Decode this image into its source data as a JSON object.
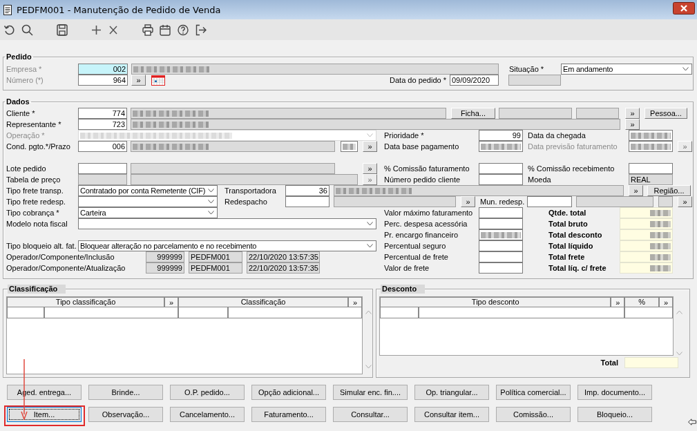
{
  "window": {
    "title": "PEDFM001 - Manutenção de Pedido de Venda"
  },
  "pedido": {
    "title": "Pedido",
    "rows": [
      {
        "items": [
          {
            "kind": "label",
            "text": "Empresa *",
            "disabled": true
          },
          {
            "kind": "field",
            "value": "002",
            "readonly": false,
            "redacted": false,
            "focused": true
          },
          {
            "kind": "field",
            "readonly": true,
            "redacted": true,
            "focused": false
          },
          {
            "kind": "label",
            "text": "Situação *",
            "disabled": false
          },
          {
            "kind": "combo",
            "value": "Em andamento",
            "disabled": false
          }
        ]
      },
      {
        "items": [
          {
            "kind": "label",
            "text": "Número (*)",
            "disabled": true
          },
          {
            "kind": "field",
            "value": "964",
            "readonly": false,
            "redacted": false,
            "focused": false
          },
          {
            "kind": "button",
            "text": "»",
            "disabled": false
          },
          {
            "kind": "calendar"
          },
          {
            "kind": "label",
            "text": "Data do pedido *",
            "disabled": false
          },
          {
            "kind": "field",
            "value": "09/09/2020",
            "readonly": false,
            "redacted": false,
            "focused": false
          },
          {
            "kind": "field",
            "readonly": true,
            "redacted": false,
            "focused": false
          }
        ]
      }
    ]
  },
  "dados": {
    "title": "Dados",
    "rows": [
      {
        "items": [
          {
            "kind": "label",
            "text": "Cliente *",
            "disabled": false
          },
          {
            "kind": "field",
            "value": "774",
            "readonly": false,
            "redacted": false
          },
          {
            "kind": "field",
            "readonly": true,
            "redacted": true
          },
          {
            "kind": "button",
            "text": "Ficha...",
            "disabled": false
          },
          {
            "kind": "field",
            "readonly": true,
            "redacted": false
          },
          {
            "kind": "field",
            "readonly": true,
            "redacted": false
          },
          {
            "kind": "button",
            "text": "»",
            "disabled": false
          },
          {
            "kind": "button",
            "text": "Pessoa...",
            "disabled": false
          }
        ]
      },
      {
        "items": [
          {
            "kind": "label",
            "text": "Representante *",
            "disabled": false
          },
          {
            "kind": "field",
            "value": "723",
            "readonly": false,
            "redacted": false
          },
          {
            "kind": "field",
            "readonly": true,
            "redacted": true
          },
          {
            "kind": "button",
            "text": "»",
            "disabled": false
          }
        ]
      },
      {
        "items": [
          {
            "kind": "label",
            "text": "Operação *",
            "disabled": true
          },
          {
            "kind": "combo",
            "disabled": true,
            "redacted": true
          },
          {
            "kind": "label",
            "text": "Prioridade *",
            "disabled": false
          },
          {
            "kind": "field",
            "value": "99",
            "readonly": false,
            "redacted": false
          },
          {
            "kind": "label",
            "text": "Data da chegada",
            "disabled": false
          },
          {
            "kind": "field",
            "readonly": false,
            "redacted": true
          }
        ]
      },
      {
        "items": [
          {
            "kind": "label",
            "text": "Cond. pgto.*/Prazo",
            "disabled": false
          },
          {
            "kind": "field",
            "value": "006",
            "readonly": false,
            "redacted": false
          },
          {
            "kind": "field",
            "readonly": true,
            "redacted": true
          },
          {
            "kind": "field",
            "readonly": false,
            "redacted": true
          },
          {
            "kind": "button",
            "text": "»",
            "disabled": false
          },
          {
            "kind": "label",
            "text": "Data base pagamento",
            "disabled": false
          },
          {
            "kind": "field",
            "readonly": false,
            "redacted": true
          },
          {
            "kind": "label",
            "text": "Data previsão faturamento",
            "disabled": true
          },
          {
            "kind": "field",
            "readonly": false,
            "redacted": true
          },
          {
            "kind": "button",
            "text": "»",
            "disabled": true
          }
        ]
      },
      {
        "items": [
          {
            "kind": "label",
            "text": "Lote pedido",
            "disabled": false
          },
          {
            "kind": "field",
            "readonly": false,
            "redacted": false
          },
          {
            "kind": "field",
            "readonly": true,
            "redacted": false
          },
          {
            "kind": "button",
            "text": "»",
            "disabled": false
          },
          {
            "kind": "label",
            "text": "% Comissão faturamento",
            "disabled": false
          },
          {
            "kind": "field",
            "readonly": false,
            "redacted": false
          },
          {
            "kind": "label",
            "text": "% Comissão recebimento",
            "disabled": false
          },
          {
            "kind": "field",
            "readonly": false,
            "redacted": false
          }
        ]
      },
      {
        "items": [
          {
            "kind": "label",
            "text": "Tabela de preço",
            "disabled": false
          },
          {
            "kind": "field",
            "readonly": true,
            "redacted": false
          },
          {
            "kind": "field",
            "readonly": true,
            "redacted": false
          },
          {
            "kind": "button",
            "text": "»",
            "disabled": true
          },
          {
            "kind": "label",
            "text": "Número pedido cliente",
            "disabled": false
          },
          {
            "kind": "field",
            "readonly": false,
            "redacted": false
          },
          {
            "kind": "label",
            "text": "Moeda",
            "disabled": false
          },
          {
            "kind": "field",
            "value": "REAL",
            "readonly": true,
            "redacted": false
          }
        ]
      },
      {
        "items": [
          {
            "kind": "label",
            "text": "Tipo frete transp.",
            "disabled": false
          },
          {
            "kind": "combo",
            "value": "Contratado por conta Remetente (CIF)",
            "disabled": false,
            "redacted": false
          },
          {
            "kind": "label",
            "text": "Transportadora",
            "disabled": false
          },
          {
            "kind": "field",
            "value": "36",
            "readonly": false,
            "redacted": false
          },
          {
            "kind": "field",
            "readonly": true,
            "redacted": true
          },
          {
            "kind": "button",
            "text": "»",
            "disabled": false
          },
          {
            "kind": "button",
            "text": "Região...",
            "disabled": false
          }
        ]
      },
      {
        "items": [
          {
            "kind": "label",
            "text": "Tipo frete redesp.",
            "disabled": false
          },
          {
            "kind": "combo",
            "disabled": false,
            "redacted": false
          },
          {
            "kind": "label",
            "text": "Redespacho",
            "disabled": false
          },
          {
            "kind": "field",
            "readonly": false,
            "redacted": false
          },
          {
            "kind": "field",
            "readonly": true,
            "redacted": false
          },
          {
            "kind": "button",
            "text": "»",
            "disabled": false
          },
          {
            "kind": "label",
            "text": "Mun. redesp.",
            "disabled": false
          },
          {
            "kind": "field",
            "readonly": false,
            "redacted": false
          },
          {
            "kind": "field",
            "readonly": true,
            "redacted": false
          },
          {
            "kind": "field",
            "readonly": true,
            "redacted": false
          },
          {
            "kind": "button",
            "text": "»",
            "disabled": false
          }
        ]
      },
      {
        "items": [
          {
            "kind": "label",
            "text": "Tipo cobrança *",
            "disabled": false
          },
          {
            "kind": "combo",
            "value": "Carteira",
            "disabled": false,
            "redacted": false
          },
          {
            "kind": "label",
            "text": "Valor máximo faturamento",
            "disabled": false
          },
          {
            "kind": "field",
            "readonly": false,
            "redacted": false
          },
          {
            "kind": "total-label",
            "text": "Qtde. total"
          },
          {
            "kind": "total-field",
            "redacted": true
          }
        ]
      },
      {
        "items": [
          {
            "kind": "label",
            "text": "Modelo nota fiscal",
            "disabled": false
          },
          {
            "kind": "combo",
            "disabled": false,
            "redacted": false
          },
          {
            "kind": "label",
            "text": "Perc. despesa acessória",
            "disabled": false
          },
          {
            "kind": "field",
            "readonly": false,
            "redacted": false
          },
          {
            "kind": "total-label",
            "text": "Total bruto"
          },
          {
            "kind": "total-field",
            "redacted": true
          }
        ]
      },
      {
        "items": [
          {
            "kind": "label",
            "text": "Pr. encargo financeiro",
            "disabled": false
          },
          {
            "kind": "field",
            "readonly": false,
            "redacted": true
          },
          {
            "kind": "total-label",
            "text": "Total desconto"
          },
          {
            "kind": "total-field",
            "redacted": true
          }
        ]
      },
      {
        "items": [
          {
            "kind": "label",
            "text": "Tipo bloqueio alt. fat.",
            "disabled": false
          },
          {
            "kind": "combo",
            "value": "Bloquear alteração no parcelamento e no recebimento",
            "disabled": false,
            "redacted": false
          },
          {
            "kind": "label",
            "text": "Percentual seguro",
            "disabled": false
          },
          {
            "kind": "field",
            "readonly": false,
            "redacted": false
          },
          {
            "kind": "total-label",
            "text": "Total líquido"
          },
          {
            "kind": "total-field",
            "redacted": true
          }
        ]
      },
      {
        "items": [
          {
            "kind": "label",
            "text": "Operador/Componente/Inclusão",
            "disabled": false
          },
          {
            "kind": "field",
            "value": "999999",
            "readonly": true,
            "redacted": false
          },
          {
            "kind": "field",
            "value": "PEDFM001",
            "readonly": true,
            "redacted": false
          },
          {
            "kind": "field",
            "value": "22/10/2020 13:57:35",
            "readonly": true,
            "redacted": false
          },
          {
            "kind": "label",
            "text": "Percentual de frete",
            "disabled": false
          },
          {
            "kind": "field",
            "readonly": false,
            "redacted": false
          },
          {
            "kind": "total-label",
            "text": "Total frete"
          },
          {
            "kind": "total-field",
            "redacted": true
          }
        ]
      },
      {
        "items": [
          {
            "kind": "label",
            "text": "Operador/Componente/Atualização",
            "disabled": false
          },
          {
            "kind": "field",
            "value": "999999",
            "readonly": true,
            "redacted": false
          },
          {
            "kind": "field",
            "value": "PEDFM001",
            "readonly": true,
            "redacted": false
          },
          {
            "kind": "field",
            "value": "22/10/2020 13:57:35",
            "readonly": true,
            "redacted": false
          },
          {
            "kind": "label",
            "text": "Valor de frete",
            "disabled": false
          },
          {
            "kind": "field",
            "readonly": false,
            "redacted": false
          },
          {
            "kind": "total-label",
            "text": "Total líq. c/ frete"
          },
          {
            "kind": "total-field",
            "redacted": true
          }
        ]
      }
    ]
  },
  "classificacao": {
    "title": "Classificação",
    "header": [
      {
        "kind": "header",
        "text": "Tipo classificação"
      },
      {
        "kind": "button",
        "text": "»"
      },
      {
        "kind": "header",
        "text": "Classificação"
      },
      {
        "kind": "button",
        "text": "»"
      }
    ]
  },
  "desconto": {
    "title": "Desconto",
    "header": [
      {
        "kind": "header",
        "text": "Tipo desconto"
      },
      {
        "kind": "button",
        "text": "»"
      },
      {
        "kind": "header",
        "text": "%"
      },
      {
        "kind": "button",
        "text": "»"
      }
    ],
    "total_label": "Total"
  },
  "button_rows": [
    {
      "buttons": [
        {
          "label": "Aged. entrega...",
          "focused": false
        },
        {
          "label": "Brinde...",
          "focused": false
        },
        {
          "label": "O.P. pedido...",
          "focused": false
        },
        {
          "label": "Opção adicional...",
          "focused": false
        },
        {
          "label": "Simular enc. fin....",
          "focused": false
        },
        {
          "label": "Op. triangular...",
          "focused": false
        },
        {
          "label": "Política comercial...",
          "focused": false
        },
        {
          "label": "Imp. documento...",
          "focused": false
        }
      ]
    },
    {
      "buttons": [
        {
          "label": "Item...",
          "focused": true
        },
        {
          "label": "Observação...",
          "focused": false
        },
        {
          "label": "Cancelamento...",
          "focused": false
        },
        {
          "label": "Faturamento...",
          "focused": false
        },
        {
          "label": "Consultar...",
          "focused": false
        },
        {
          "label": "Consultar item...",
          "focused": false
        },
        {
          "label": "Comissão...",
          "focused": false
        },
        {
          "label": "Bloqueio...",
          "focused": false
        }
      ]
    }
  ]
}
